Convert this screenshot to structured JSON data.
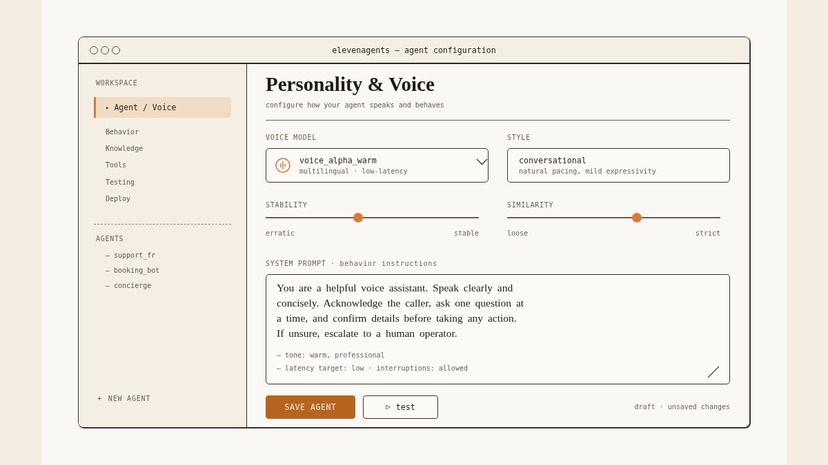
{
  "window": {
    "title": "elevenagents — agent configuration"
  },
  "sidebar": {
    "sections": [
      {
        "kind": "nav",
        "heading": "WORKSPACE",
        "items": [
          {
            "label": "Agent / Voice",
            "marker": "▸",
            "selected": true
          },
          {
            "label": "Behavior",
            "selected": false
          },
          {
            "label": "Knowledge",
            "selected": false
          },
          {
            "label": "Tools",
            "selected": false
          },
          {
            "label": "Testing",
            "selected": false
          },
          {
            "label": "Deploy",
            "selected": false
          }
        ]
      },
      {
        "kind": "agents",
        "heading": "AGENTS",
        "items": [
          {
            "label": "— support_fr"
          },
          {
            "label": "— booking_bot"
          },
          {
            "label": "— concierge"
          }
        ]
      }
    ],
    "new_button": {
      "icon": "+",
      "label": "NEW AGENT"
    }
  },
  "header": {
    "title": "Personality & Voice",
    "subtitle": "configure how your agent speaks and behaves"
  },
  "fields": [
    {
      "kind": "select",
      "label": "VOICE MODEL",
      "value": "voice_alpha_warm",
      "detail": "multilingual · low-latency"
    },
    {
      "kind": "display",
      "label": "STYLE",
      "value": "conversational",
      "detail": "natural pacing, mild expressivity"
    }
  ],
  "sliders": [
    {
      "label": "STABILITY",
      "level": 0.435,
      "min_label": "erratic",
      "max_label": "stable"
    },
    {
      "label": "SIMILARITY",
      "level": 0.61,
      "min_label": "loose",
      "max_label": "strict"
    }
  ],
  "system_prompt": {
    "label": "SYSTEM PROMPT · behavior instructions",
    "text": "You are a helpful voice assistant. Speak clearly and concisely. Acknowledge the caller, ask one question at a time, and confirm details before taking any action. If unsure, escalate to a human operator.",
    "notes": [
      "— tone: warm, professional",
      "— latency target: low · interruptions: allowed"
    ]
  },
  "actions": [
    {
      "kind": "primary",
      "label": "SAVE AGENT"
    },
    {
      "kind": "secondary",
      "icon": "▷",
      "label": "test"
    }
  ],
  "status": "draft · unsaved changes"
}
